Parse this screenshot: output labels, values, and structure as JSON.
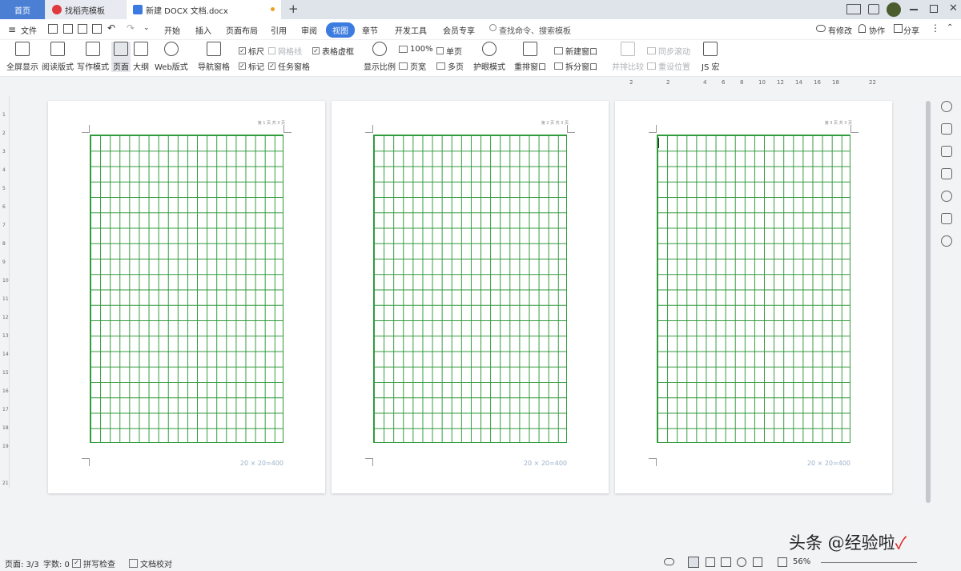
{
  "tabs": {
    "home": "首页",
    "template": "找稻壳模板",
    "doc": "新建 DOCX 文档.docx",
    "new": "+"
  },
  "toolbar": {
    "file": "文件",
    "menus": [
      "开始",
      "插入",
      "页面布局",
      "引用",
      "审阅",
      "视图",
      "章节",
      "开发工具",
      "会员专享"
    ],
    "active": "视图",
    "search": "查找命令、搜索模板",
    "has_changes": "有修改",
    "collab": "协作",
    "share": "分享"
  },
  "ribbon": {
    "fullscreen": "全屏显示",
    "read": "阅读版式",
    "write": "写作模式",
    "page": "页面",
    "outline": "大纲",
    "web": "Web版式",
    "nav": "导航窗格",
    "ruler": "标尺",
    "gridlines": "网格线",
    "table_border": "表格虚框",
    "mark": "标记",
    "task_pane": "任务窗格",
    "zoom_label": "显示比例",
    "zoom100": "100%",
    "single": "单页",
    "page_width": "页宽",
    "multi": "多页",
    "eye": "护眼模式",
    "rearrange": "重排窗口",
    "new_window": "新建窗口",
    "split": "拆分窗口",
    "compare": "并排比较",
    "sync_scroll": "同步滚动",
    "reset_pos": "重设位置",
    "macro": "JS 宏"
  },
  "hruler_labels": [
    "2",
    "",
    "2",
    "",
    "4",
    "6",
    "8",
    "10",
    "12",
    "14",
    "16",
    "18",
    "",
    "22"
  ],
  "vruler_labels": [
    "1",
    "2",
    "3",
    "4",
    "5",
    "6",
    "7",
    "8",
    "9",
    "10",
    "11",
    "12",
    "13",
    "14",
    "15",
    "16",
    "17",
    "18",
    "19",
    "",
    "21"
  ],
  "pages": [
    {
      "num": "第 1 页 共 3 页",
      "count": "20 × 20=400"
    },
    {
      "num": "第 2 页 共 3 页",
      "count": "20 × 20=400"
    },
    {
      "num": "第 3 页 共 3 页",
      "count": "20 × 20=400"
    }
  ],
  "status": {
    "page": "页面: 3/3",
    "words": "字数: 0",
    "spell": "拼写检查",
    "proof": "文档校对",
    "zoom": "56%"
  },
  "watermark": "头条 @经验啦"
}
